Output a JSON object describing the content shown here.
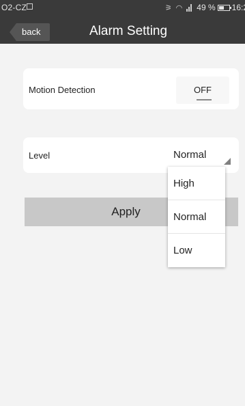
{
  "status_bar": {
    "carrier": "O2-CZ",
    "battery_percent": "49 %",
    "time": "16:2",
    "icons": [
      "image-icon",
      "mute-icon",
      "wifi-icon",
      "signal-icon",
      "battery-icon"
    ]
  },
  "header": {
    "back_label": "back",
    "title": "Alarm Setting"
  },
  "motion_detection": {
    "label": "Motion Detection",
    "toggle_label": "OFF"
  },
  "level": {
    "label": "Level",
    "selected": "Normal",
    "options": [
      "High",
      "Normal",
      "Low"
    ]
  },
  "apply_label": "Apply",
  "colors": {
    "header_bg": "#3a3a3a",
    "page_bg": "#f3f3f3",
    "card_bg": "#ffffff",
    "apply_bg": "#c8c8c8",
    "back_button_bg": "#555555"
  }
}
